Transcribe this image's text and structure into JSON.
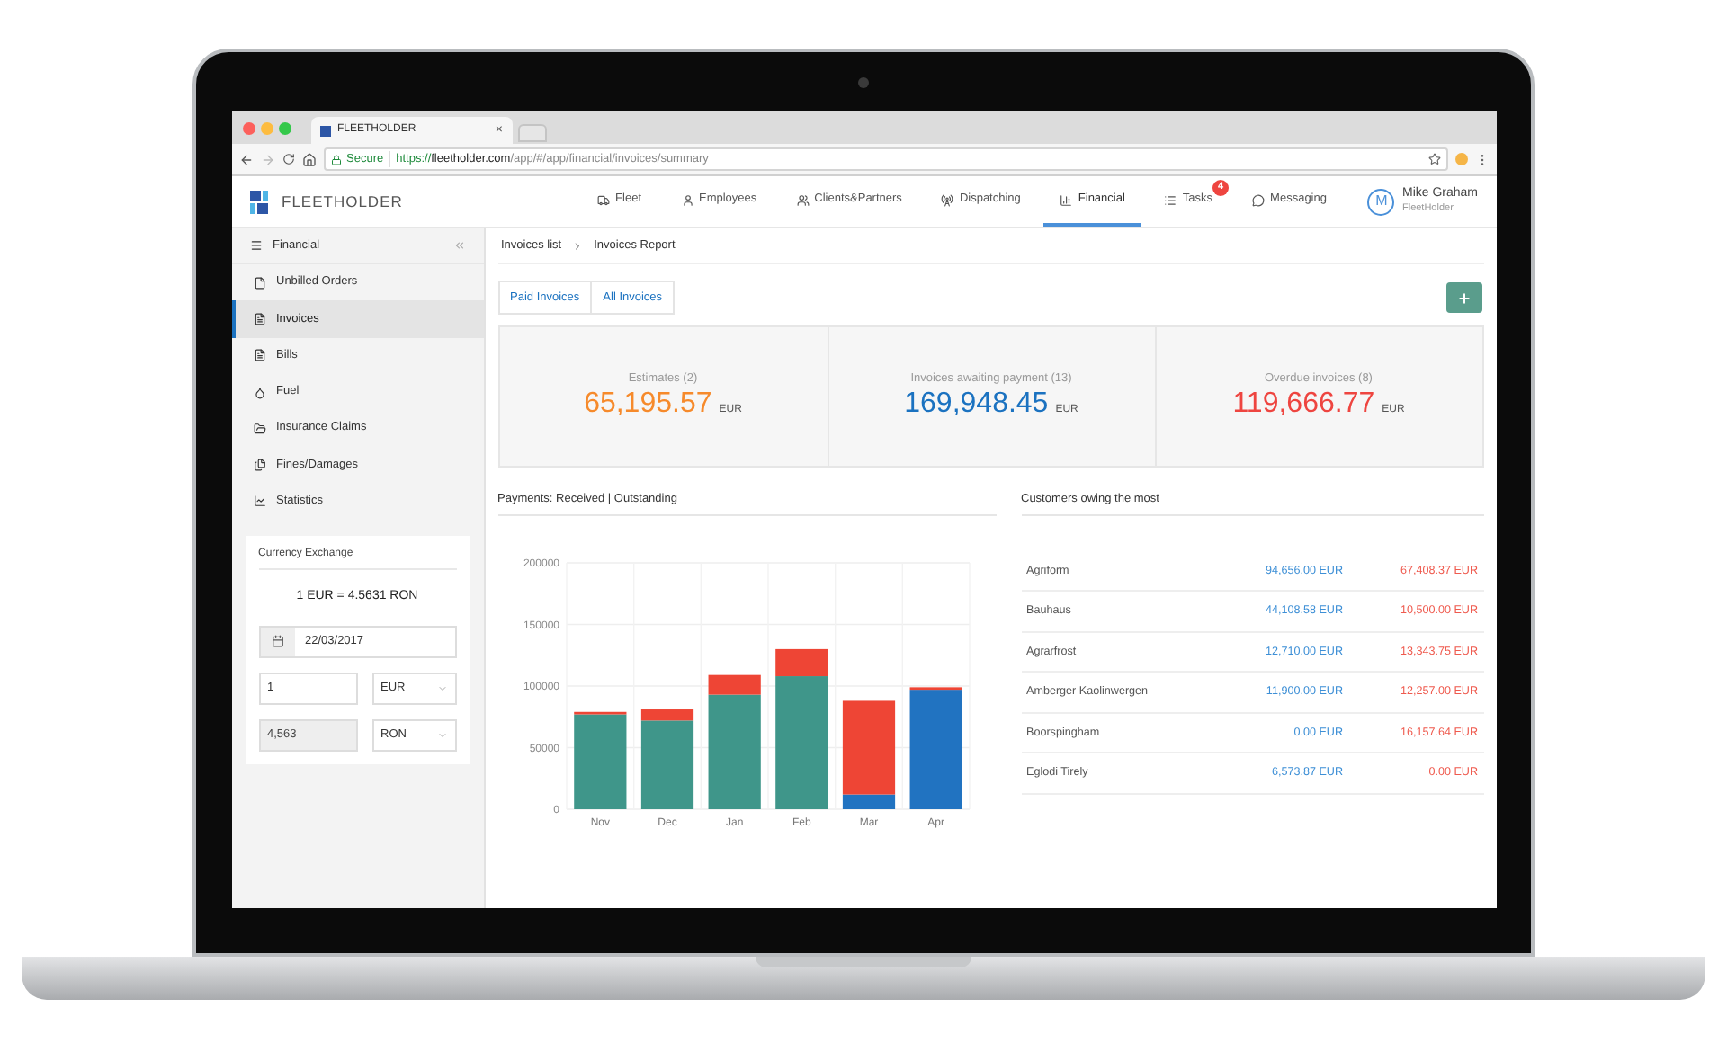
{
  "browser": {
    "tab_title": "FLEETHOLDER",
    "tab_close": "×",
    "secure_label": "Secure",
    "url_scheme": "https://",
    "url_host": "fleetholder.com",
    "url_path": "/app/#/app/financial/invoices/summary"
  },
  "app_header": {
    "logo": "FLEETHOLDER",
    "nav": [
      {
        "label": "Fleet",
        "selected": false
      },
      {
        "label": "Employees",
        "selected": false
      },
      {
        "label": "Clients&Partners",
        "selected": false
      },
      {
        "label": "Dispatching",
        "selected": false
      },
      {
        "label": "Financial",
        "selected": true
      },
      {
        "label": "Tasks",
        "selected": false,
        "badge": "4"
      },
      {
        "label": "Messaging",
        "selected": false
      }
    ],
    "user": {
      "initial": "M",
      "name": "Mike Graham",
      "company": "FleetHolder"
    }
  },
  "sidebar": {
    "title": "Financial",
    "items": [
      {
        "label": "Unbilled Orders",
        "selected": false
      },
      {
        "label": "Invoices",
        "selected": true
      },
      {
        "label": "Bills",
        "selected": false
      },
      {
        "label": "Fuel",
        "selected": false
      },
      {
        "label": "Insurance Claims",
        "selected": false
      },
      {
        "label": "Fines/Damages",
        "selected": false
      },
      {
        "label": "Statistics",
        "selected": false
      }
    ],
    "currency_exchange": {
      "title": "Currency Exchange",
      "rate": "1 EUR = 4.5631 RON",
      "date": "22/03/2017",
      "amount": "1",
      "from_currency": "EUR",
      "result": "4,563",
      "to_currency": "RON"
    }
  },
  "breadcrumb": [
    "Invoices list",
    "Invoices Report"
  ],
  "tabs": [
    {
      "label": "Paid Invoices",
      "selected": false
    },
    {
      "label": "All Invoices",
      "selected": false
    }
  ],
  "summary_cards": [
    {
      "label": "Estimates (2)",
      "amount": "65,195.57",
      "currency": "EUR",
      "color": "#f68a2b"
    },
    {
      "label": "Invoices awaiting payment (13)",
      "amount": "169,948.45",
      "currency": "EUR",
      "color": "#1b72c0"
    },
    {
      "label": "Overdue invoices (8)",
      "amount": "119,666.77",
      "currency": "EUR",
      "color": "#ee4540"
    }
  ],
  "payments": {
    "title": "Payments: Received | Outstanding",
    "chart_data": {
      "type": "bar",
      "stacked": true,
      "grid": true,
      "categories": [
        "Nov",
        "Dec",
        "Jan",
        "Feb",
        "Mar",
        "Apr"
      ],
      "ylim": [
        0,
        200000
      ],
      "yticks": [
        0,
        50000,
        100000,
        150000,
        200000
      ],
      "series": [
        {
          "color": "#3f968a",
          "values": [
            77000,
            72000,
            93000,
            108000,
            0,
            0
          ]
        },
        {
          "color": "#2173c1",
          "values": [
            0,
            0,
            0,
            0,
            12000,
            97000
          ]
        },
        {
          "color": "#ee4535",
          "values": [
            2000,
            9000,
            16000,
            22000,
            76000,
            2000
          ]
        }
      ]
    }
  },
  "customers": {
    "title": "Customers owing the most",
    "rows": [
      {
        "name": "Agriform",
        "received": "94,656.00 EUR",
        "outstanding": "67,408.37 EUR"
      },
      {
        "name": "Bauhaus",
        "received": "44,108.58 EUR",
        "outstanding": "10,500.00 EUR"
      },
      {
        "name": "Agrarfrost",
        "received": "12,710.00 EUR",
        "outstanding": "13,343.75 EUR"
      },
      {
        "name": "Amberger Kaolinwergen",
        "received": "11,900.00 EUR",
        "outstanding": "12,257.00 EUR"
      },
      {
        "name": "Boorspingham",
        "received": "0.00 EUR",
        "outstanding": "16,157.64 EUR"
      },
      {
        "name": "Eglodi Tirely",
        "received": "6,573.87 EUR",
        "outstanding": "0.00 EUR"
      }
    ]
  }
}
